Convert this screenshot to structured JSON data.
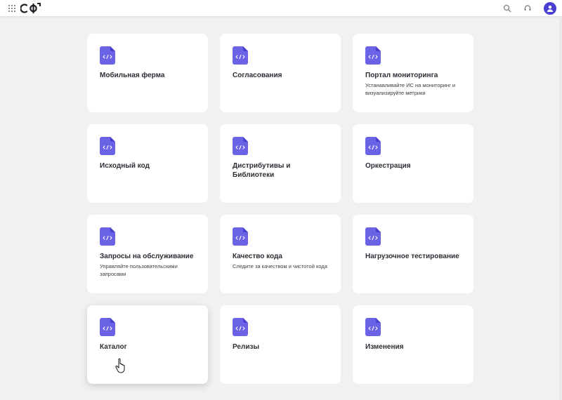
{
  "header": {
    "logo_text": "СФ",
    "icons": [
      "apps-grid-icon",
      "search-icon",
      "support-icon",
      "user-avatar-icon"
    ]
  },
  "colors": {
    "accent": "#6b63e6",
    "accent_dark": "#4a3fd0",
    "background": "#f1f1f3",
    "card": "#ffffff"
  },
  "cards": [
    {
      "id": "mobile-farm",
      "title": "Мобильная ферма",
      "desc": ""
    },
    {
      "id": "approvals",
      "title": "Согласования",
      "desc": ""
    },
    {
      "id": "monitoring-portal",
      "title": "Портал мониторинга",
      "desc": "Устанавливайте ИС на мониторинг и визуализируйте метрики"
    },
    {
      "id": "source-code",
      "title": "Исходный код",
      "desc": ""
    },
    {
      "id": "distributions-libraries",
      "title": "Дистрибутивы и Библиотеки",
      "desc": ""
    },
    {
      "id": "orchestration",
      "title": "Оркестрация",
      "desc": ""
    },
    {
      "id": "service-requests",
      "title": "Запросы на обслуживание",
      "desc": "Управляйте пользовательскими запросами"
    },
    {
      "id": "code-quality",
      "title": "Качество кода",
      "desc": "Следите за качеством и чистотой кода"
    },
    {
      "id": "load-testing",
      "title": "Нагрузочное тестирование",
      "desc": ""
    },
    {
      "id": "catalog",
      "title": "Каталог",
      "desc": "",
      "hovered": true
    },
    {
      "id": "releases",
      "title": "Релизы",
      "desc": ""
    },
    {
      "id": "changes",
      "title": "Изменения",
      "desc": ""
    }
  ]
}
